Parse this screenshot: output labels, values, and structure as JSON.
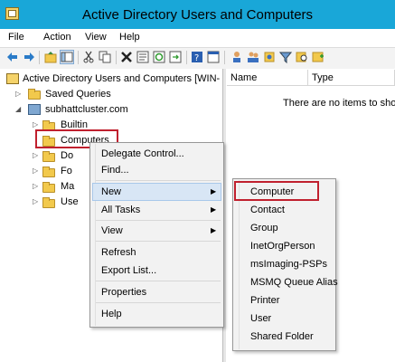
{
  "window": {
    "title": "Active Directory Users and Computers"
  },
  "menubar": [
    "File",
    "Action",
    "View",
    "Help"
  ],
  "toolbar": {
    "icons": [
      "back-arrow-icon",
      "forward-arrow-icon",
      "up-folder-icon",
      "show-hide-tree-icon",
      "cut-icon",
      "copy-icon",
      "delete-icon",
      "properties-icon",
      "refresh-icon",
      "export-list-icon",
      "help-icon",
      "console-icon",
      "users-icon",
      "groups-icon",
      "group-icon",
      "filter-icon",
      "find-icon",
      "add-to-group-icon"
    ]
  },
  "tree": {
    "root": "Active Directory Users and Computers [WIN-",
    "saved_queries": "Saved Queries",
    "domain": "subhattcluster.com",
    "builtin": "Builtin",
    "computers": "Computers",
    "partial": [
      "Do",
      "Fo",
      "Ma",
      "Use"
    ]
  },
  "list": {
    "columns": [
      "Name",
      "Type"
    ],
    "empty_message": "There are no items to show"
  },
  "context_menu": {
    "items": [
      "Delegate Control...",
      "Find...",
      "New",
      "All Tasks",
      "View",
      "Refresh",
      "Export List...",
      "Properties",
      "Help"
    ]
  },
  "new_submenu": {
    "items": [
      "Computer",
      "Contact",
      "Group",
      "InetOrgPerson",
      "msImaging-PSPs",
      "MSMQ Queue Alias",
      "Printer",
      "User",
      "Shared Folder"
    ]
  },
  "colors": {
    "titlebar": "#19a7d8",
    "highlight": "#c0202e",
    "menu_hover": "#d8e6f5"
  }
}
